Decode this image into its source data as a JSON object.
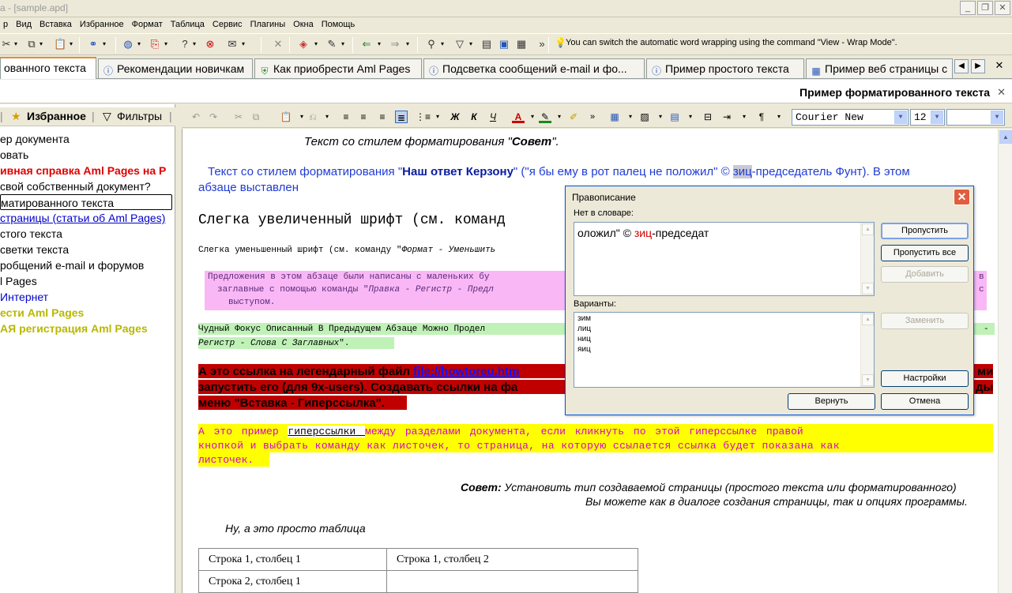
{
  "window": {
    "title": "a - [sample.apd]",
    "buttons": [
      "_",
      "❐",
      "✕"
    ]
  },
  "menu": [
    "р",
    "Вид",
    "Вставка",
    "Избранное",
    "Формат",
    "Таблица",
    "Сервис",
    "Плагины",
    "Окна",
    "Помощь"
  ],
  "hint_text": "You can switch the automatic word wrapping using the command \"View - Wrap Mode\".",
  "tabs": [
    {
      "label": "ованного текста"
    },
    {
      "label": "Рекомендации новичкам"
    },
    {
      "label": "Как приобрести Aml Pages"
    },
    {
      "label": "Подсветка сообщений e-mail и фо..."
    },
    {
      "label": "Пример простого текста"
    },
    {
      "label": "Пример веб страницы с"
    }
  ],
  "page_title": "Пример форматированного текста",
  "left_panel": {
    "toolbar": {
      "favorites": "Избранное",
      "filters": "Фильтры"
    },
    "items": [
      {
        "text": "ер документа",
        "color": "#000000",
        "bold": false
      },
      {
        "text": "овать",
        "color": "#000000",
        "bold": false
      },
      {
        "text": "ивная справка Aml Pages на Р",
        "color": "#e00000",
        "bold": true
      },
      {
        "text": " свой собственный документ?",
        "color": "#000000",
        "bold": false
      },
      {
        "text": "",
        "color": "#000000",
        "bold": false
      },
      {
        "text": "матированного текста",
        "color": "#000000",
        "bold": false
      },
      {
        "text": "страницы (статьи об Aml Pages)",
        "color": "#0000cc",
        "bold": false
      },
      {
        "text": "стого текста",
        "color": "#000000",
        "bold": false
      },
      {
        "text": "светки текста",
        "color": "#000000",
        "bold": false
      },
      {
        "text": "робщений e-mail и форумов",
        "color": "#000000",
        "bold": false
      },
      {
        "text": "l Pages",
        "color": "#000000",
        "bold": false
      },
      {
        "text": "Интернет",
        "color": "#0000cc",
        "bold": false
      },
      {
        "text": "ести Aml Pages",
        "color": "#b8b800",
        "bold": true
      },
      {
        "text": "АЯ регистрация Aml Pages",
        "color": "#b8b800",
        "bold": true
      }
    ]
  },
  "editor_toolbar": {
    "font": "Courier New",
    "size": "12"
  },
  "document": {
    "line1_prefix": "Текст со стилем форматирования \"",
    "line1_bold": "Совет",
    "line1_suffix": "\".",
    "p2_a": "Текст со стилем форматирования \"",
    "p2_bold": "Наш ответ Керзону",
    "p2_b": "\" (\"я бы ему в рот палец не положил\" © ",
    "p2_sel": "зиц",
    "p2_c": "-председатель Фунт). В этом",
    "p2_line2": "абзаце выставлен",
    "big_font": "Слегка увеличенный шрифт (см. команд",
    "small_font_a": "Слегка уменьшенный шрифт (см. команду \"",
    "small_font_i": "Формат - Уменьшить",
    "pink_1": "Предложения в этом абзаце были написаны с маленьких бу",
    "pink_1_end": "в",
    "pink_2a": "заглавные с помощью команды \"",
    "pink_2i": "Правка - Регистр - Предл",
    "pink_2_end": "с",
    "pink_3": "выступом.",
    "green_1": "Чудный Фокус Описанный В Предыдущем Абзаце Можно Продел",
    "green_1_end": "-",
    "green_2i": "Регистр - Слова С Заглавных",
    "green_2_end": "\".",
    "red_1a": "А это ссылка на легендарный файл ",
    "red_1_link": "file://howtoreu.htm",
    "red_1_end": "ми",
    "red_2": "запустить его (для 9x-users). Создавать ссылки на фа",
    "red_2_end": "ды",
    "red_3": "меню \"Вставка - Гиперссылка\".",
    "yellow_1a": "А это пример ",
    "yellow_1_link": " гиперссылки ",
    "yellow_1b": " между разделами документа, если кликнуть по этой гиперссылке правой",
    "yellow_2": "кнопкой и выбрать команду как листочек, то страница, на которую ссылается ссылка будет показана как",
    "yellow_3": "листочек.",
    "tip_bold": "Совет:",
    "tip_1": " Установить тип создаваемой страницы (простого текста или форматированного)",
    "tip_2": "Вы можете как в диалоге создания страницы, так и опциях программы.",
    "table_intro": "Ну, а это просто таблица",
    "table": [
      [
        "Строка 1, столбец 1",
        "Строка 1, столбец 2"
      ],
      [
        "Строка 2, столбец 1",
        ""
      ]
    ]
  },
  "dialog": {
    "title": "Правописание",
    "not_in_dict_label": "Нет в словаре:",
    "context_a": "оложил\" © ",
    "context_err": "зиц",
    "context_b": "-председат",
    "variants_label": "Варианты:",
    "variants": [
      "зим",
      "лиц",
      "ниц",
      "яиц"
    ],
    "buttons": {
      "skip": "Пропустить",
      "skip_all": "Пропустить все",
      "add": "Добавить",
      "replace": "Заменить",
      "settings": "Настройки",
      "revert": "Вернуть",
      "cancel": "Отмена"
    }
  }
}
